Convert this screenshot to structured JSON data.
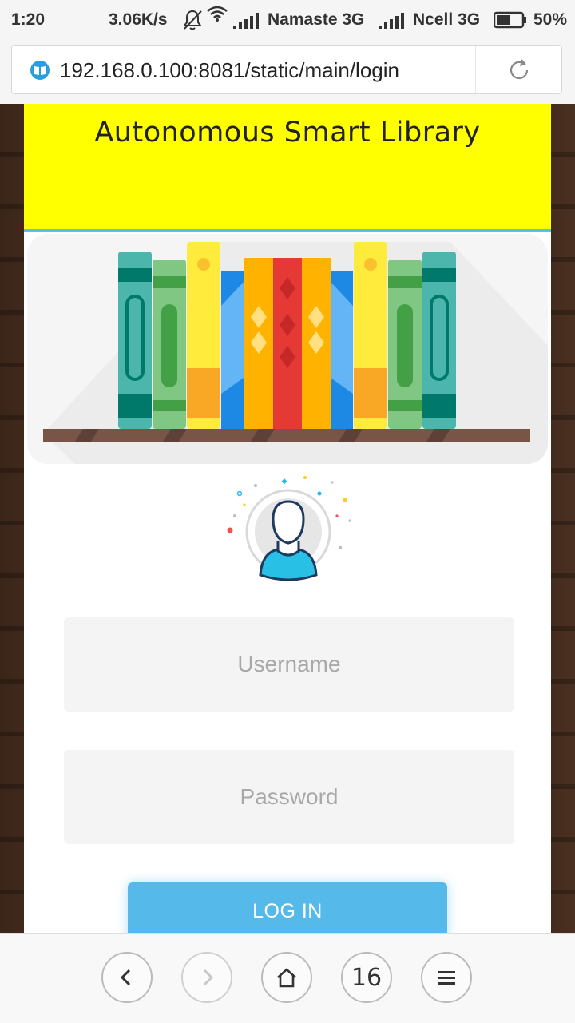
{
  "status_bar": {
    "time": "1:20",
    "net_speed": "3.06K/s",
    "carrier1": "Namaste 3G",
    "carrier2": "Ncell 3G",
    "battery": "50%"
  },
  "browser": {
    "url": "192.168.0.100:8081/static/main/login"
  },
  "page": {
    "title": "Autonomous Smart Library"
  },
  "form": {
    "username_placeholder": "Username",
    "password_placeholder": "Password",
    "login_label": "LOG IN"
  },
  "bottom_nav": {
    "tab_count": "16"
  },
  "colors": {
    "header_bg": "#ffff00",
    "header_border": "#5bc0e8",
    "button_bg": "#55b9e9",
    "field_bg": "#f4f4f4"
  },
  "icons": [
    "mute-bell-icon",
    "wifi-icon",
    "signal-icon",
    "battery-icon",
    "site-book-icon",
    "reload-icon",
    "back-icon",
    "forward-icon",
    "home-icon",
    "menu-icon"
  ]
}
